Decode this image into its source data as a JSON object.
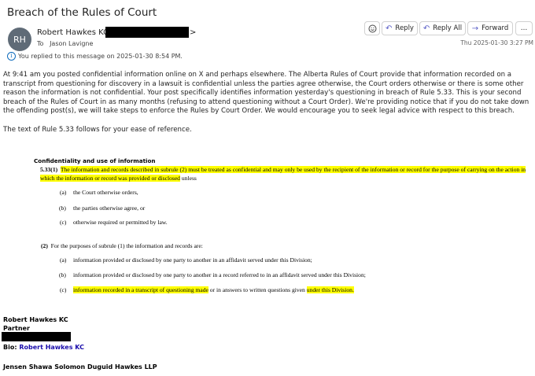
{
  "subject": "Breach of the Rules of Court",
  "sender": {
    "initials": "RH",
    "name": "Robert Hawkes KC <",
    "name_suffix": ">",
    "to_label": "To",
    "to": "Jason Lavigne"
  },
  "replied_notice": "You replied to this message on 2025-01-30 8:54 PM.",
  "toolbar": {
    "reply": "Reply",
    "reply_all": "Reply All",
    "forward": "Forward",
    "more": "…"
  },
  "timestamp": "Thu 2025-01-30 3:27 PM",
  "body": {
    "p1": "At 9:41 am you posted confidential information online on X and perhaps elsewhere. The Alberta Rules of Court provide that information recorded on a transcript from questioning for discovery in a lawsuit is confidential unless the parties agree otherwise, the Court orders otherwise or there is some other reason the information is not confidential. Your post specifically identifies information yesterday's questioning in breach of Rule 5.33. This is your second breach of the Rules of Court in as many months (refusing to attend questioning without a Court Order). We're providing notice that if you do not take down the offending post(s), we will take steps to enforce the Rules by Court Order. We would encourage you to seek legal advice with respect to this breach.",
    "p2": "The text of Rule 5.33 follows for your ease of reference."
  },
  "rule": {
    "heading": "Confidentiality and use of information",
    "number": "5.33(1)",
    "sub1_highlight": "The information and records described in subrule (2) must be treated as confidential and may only be used by the recipient of the information or record for the purpose of carrying on the action in which the information or record was provided or disclosed",
    "sub1_tail": " unless",
    "items1": [
      {
        "label": "(a)",
        "text": "the Court otherwise orders,"
      },
      {
        "label": "(b)",
        "text": "the parties otherwise agree, or"
      },
      {
        "label": "(c)",
        "text": "otherwise required or permitted by law."
      }
    ],
    "sub2_num": "(2)",
    "sub2_text": "For the purposes of subrule (1) the information and records are:",
    "items2_a_label": "(a)",
    "items2_a": "information provided or disclosed by one party to another in an affidavit served under this Division;",
    "items2_b_label": "(b)",
    "items2_b": "information provided or disclosed by one party to another in a record referred to in an affidavit served under this Division;",
    "items2_c_label": "(c)",
    "items2_c_hl1": "information recorded in a transcript of questioning made",
    "items2_c_mid": " or in answers to written questions given ",
    "items2_c_hl2": "under this Division."
  },
  "signature": {
    "name": "Robert Hawkes KC",
    "title": "Partner",
    "bio_label": "Bio: ",
    "bio_link": "Robert Hawkes KC",
    "firm": "Jensen Shawa Solomon Duguid Hawkes LLP"
  },
  "colors": {
    "accent": "#5b5fc7",
    "highlight": "#ffff00",
    "avatar": "#5f6b77",
    "link": "#1a0dab"
  }
}
